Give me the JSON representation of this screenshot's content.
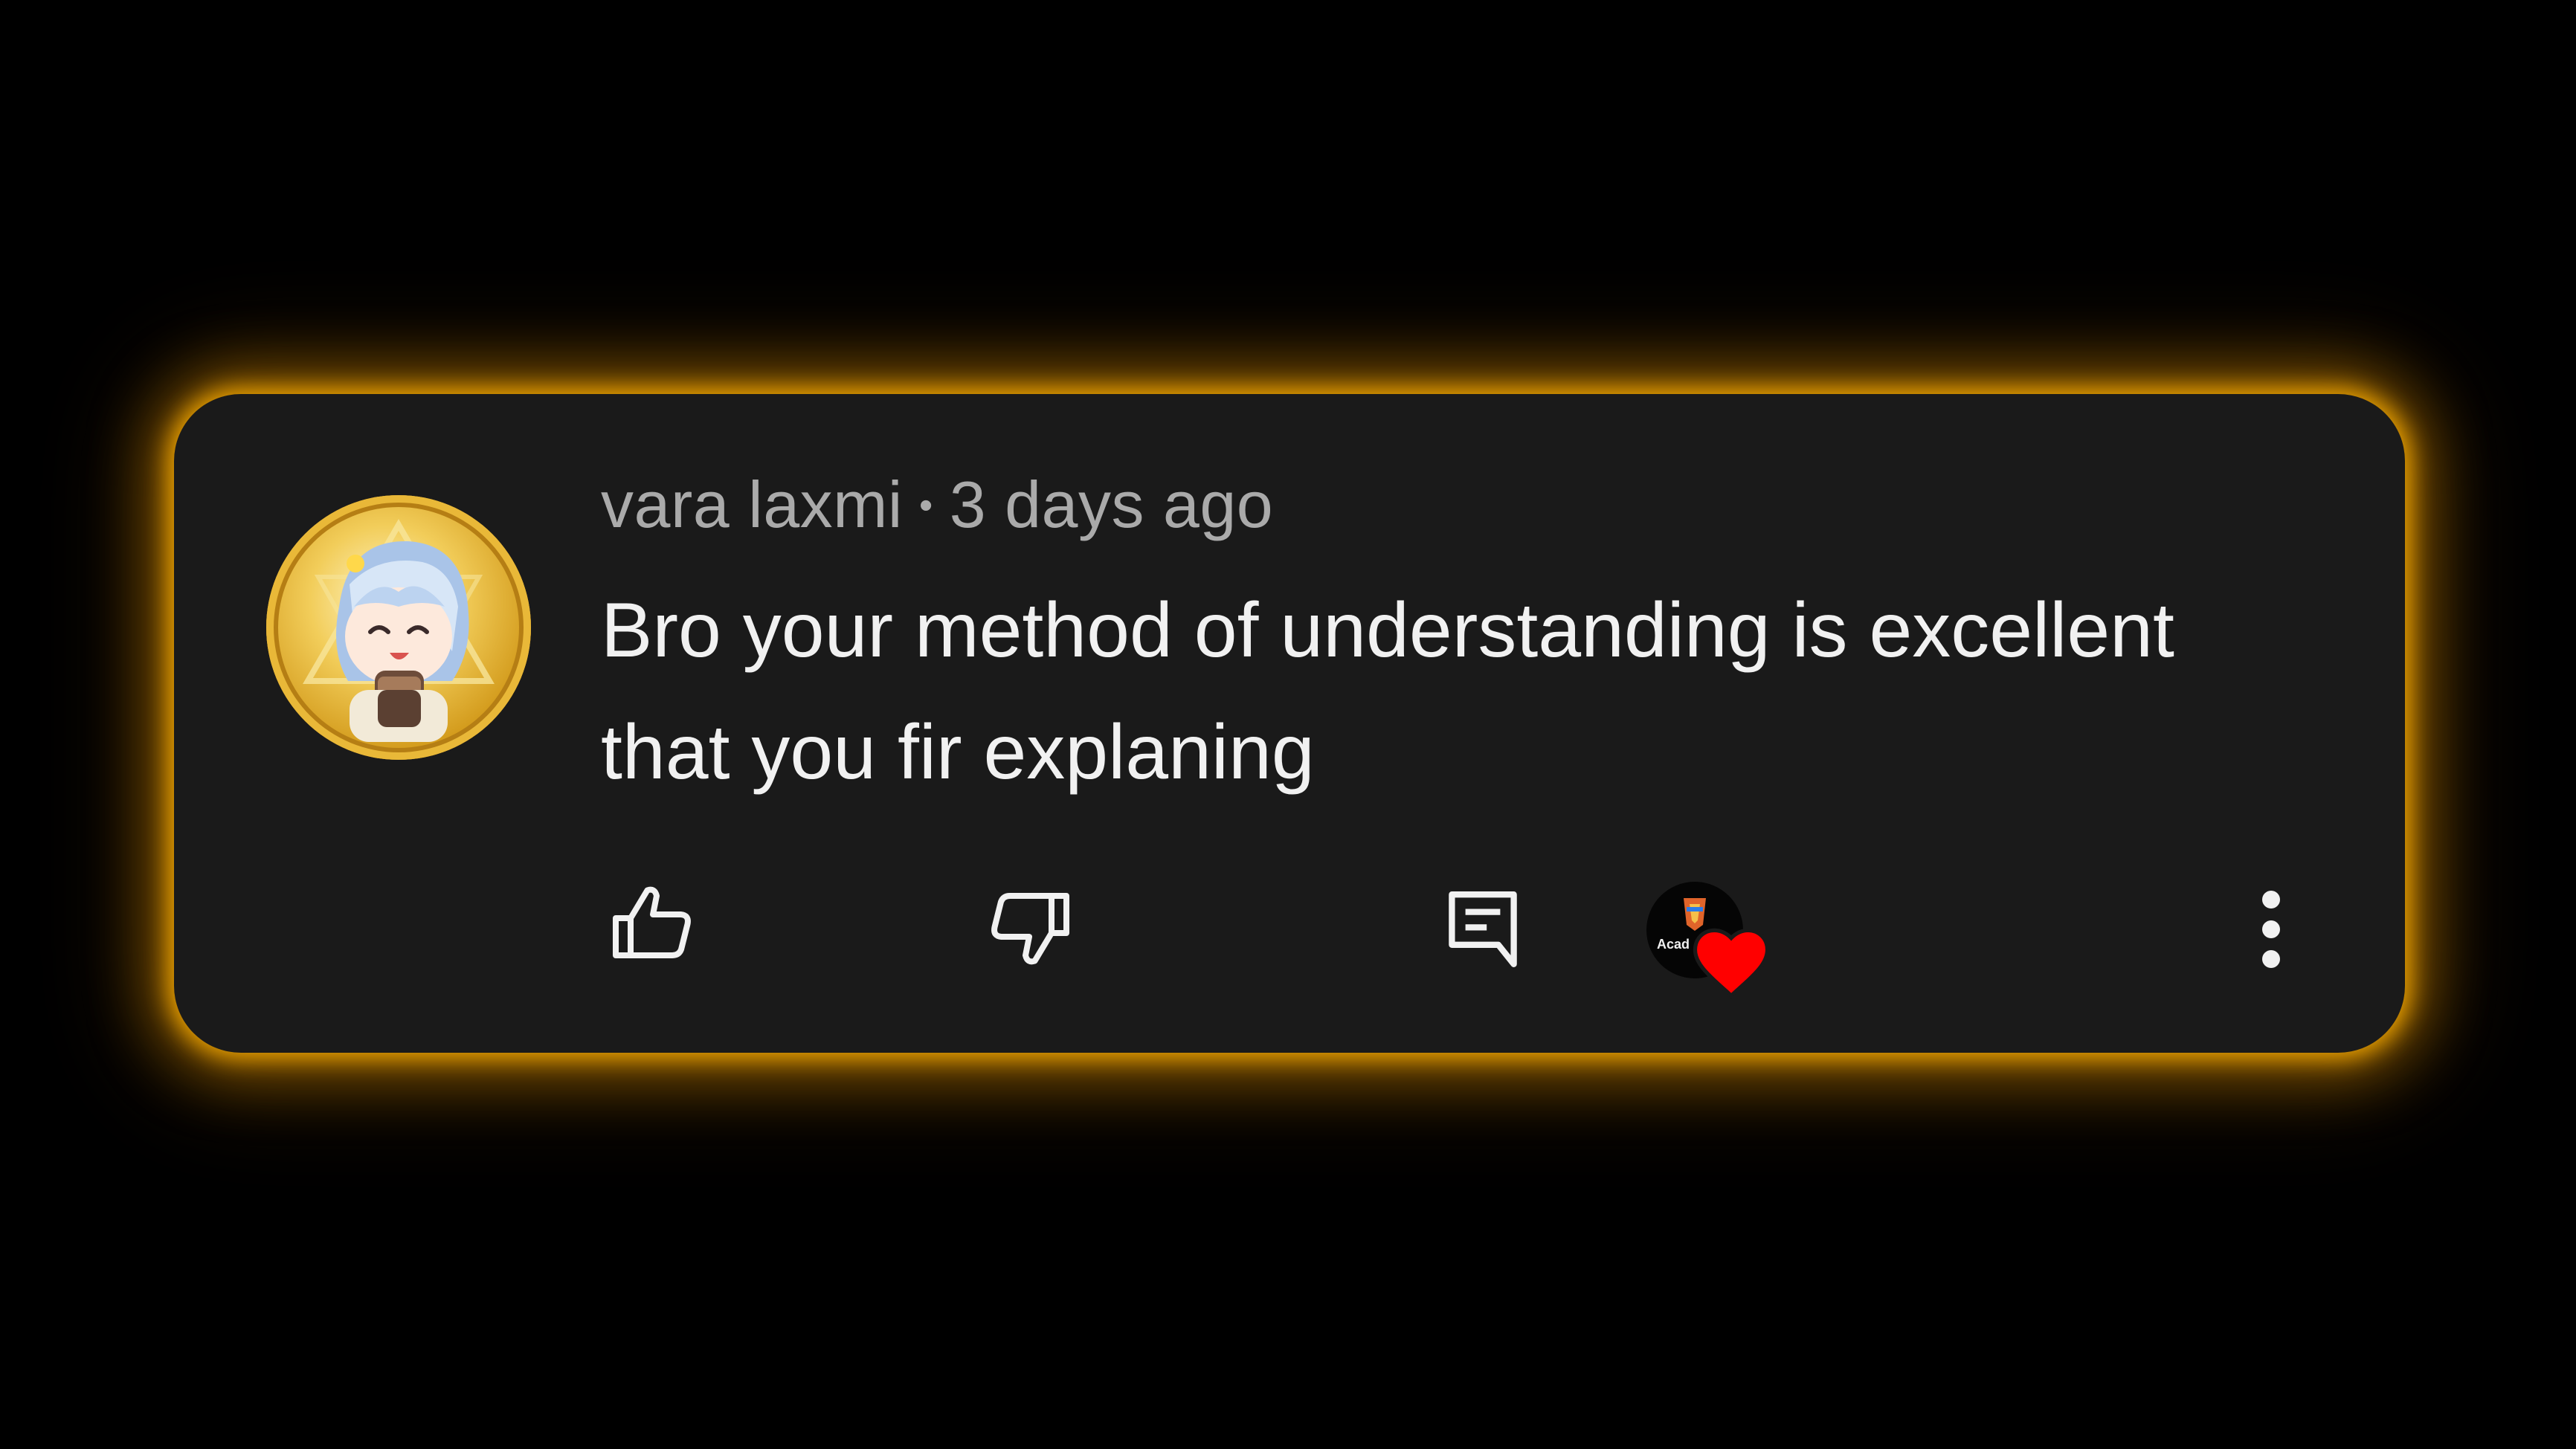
{
  "comment": {
    "author": "vara laxmi",
    "separator": "•",
    "timestamp": "3 days ago",
    "text": "Bro your method of understanding is excellent that you fir explaning"
  },
  "actions": {
    "like_icon": "thumbs-up-icon",
    "dislike_icon": "thumbs-down-icon",
    "reply_icon": "comment-reply-icon",
    "creator_heart_icon": "heart-icon",
    "creator_avatar_label": "Acad",
    "more_icon": "vertical-dots-icon"
  },
  "colors": {
    "background": "#000000",
    "card": "#1a1a1a",
    "glow": "#ffb000",
    "author_text": "#aaaaaa",
    "body_text": "#f1f1f1",
    "heart": "#ff0000"
  }
}
